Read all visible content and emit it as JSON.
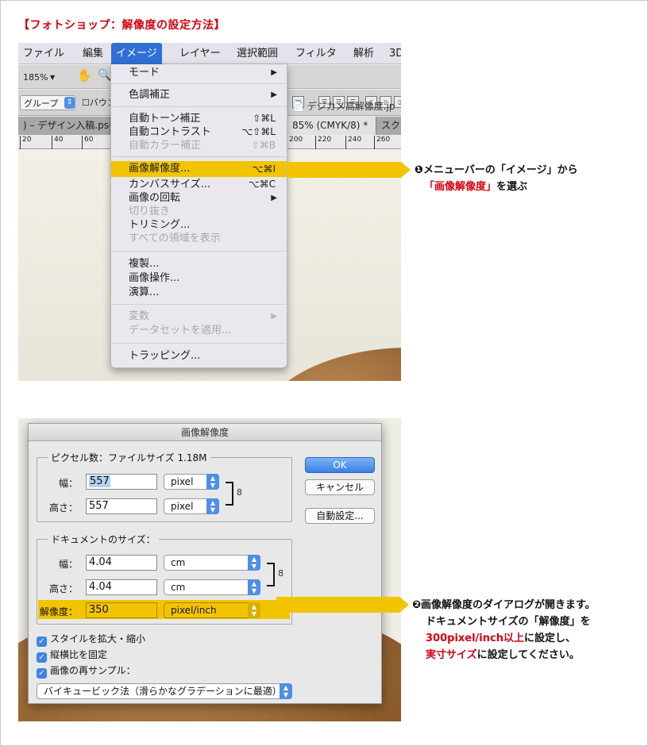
{
  "page_title": "【フォトショップ：解像度の設定方法】",
  "screenshot1": {
    "menubar": [
      "ファイル",
      "編集",
      "イメージ",
      "レイヤー",
      "選択範囲",
      "フィルタ",
      "解析",
      "3D"
    ],
    "active_menu": "イメージ",
    "options_bar": {
      "zoom": "185%",
      "zoom_arrow": "▼",
      "group_select": "グループ",
      "bounds_checkbox": "バウン"
    },
    "tabs": [
      ") – デザイン入稿.psd",
      "85% (CMYK/8) *",
      "スク"
    ],
    "doc_tab": "デジカメ高解像度.jp",
    "ruler_ticks": [
      "20",
      "40",
      "60",
      "200",
      "220",
      "240",
      "260"
    ],
    "image_menu": [
      {
        "label": "モード",
        "shortcut": "",
        "submenu": true,
        "disabled": false
      },
      {
        "label": "色調補正",
        "shortcut": "",
        "submenu": true,
        "disabled": false
      },
      {
        "label": "自動トーン補正",
        "shortcut": "⇧⌘L",
        "submenu": false,
        "disabled": false
      },
      {
        "label": "自動コントラスト",
        "shortcut": "⌥⇧⌘L",
        "submenu": false,
        "disabled": false
      },
      {
        "label": "自動カラー補正",
        "shortcut": "⇧⌘B",
        "submenu": false,
        "disabled": true
      },
      {
        "label": "画像解像度...",
        "shortcut": "⌥⌘I",
        "submenu": false,
        "disabled": false,
        "highlight": true
      },
      {
        "label": "カンバスサイズ...",
        "shortcut": "⌥⌘C",
        "submenu": false,
        "disabled": false
      },
      {
        "label": "画像の回転",
        "shortcut": "",
        "submenu": true,
        "disabled": false
      },
      {
        "label": "切り抜き",
        "shortcut": "",
        "submenu": false,
        "disabled": true
      },
      {
        "label": "トリミング...",
        "shortcut": "",
        "submenu": false,
        "disabled": false
      },
      {
        "label": "すべての領域を表示",
        "shortcut": "",
        "submenu": false,
        "disabled": true
      },
      {
        "label": "複製...",
        "shortcut": "",
        "submenu": false,
        "disabled": false
      },
      {
        "label": "画像操作...",
        "shortcut": "",
        "submenu": false,
        "disabled": false
      },
      {
        "label": "演算...",
        "shortcut": "",
        "submenu": false,
        "disabled": false
      },
      {
        "label": "変数",
        "shortcut": "",
        "submenu": true,
        "disabled": true
      },
      {
        "label": "データセットを適用...",
        "shortcut": "",
        "submenu": false,
        "disabled": true
      },
      {
        "label": "トラッピング...",
        "shortcut": "",
        "submenu": false,
        "disabled": false
      }
    ],
    "submenu_arrow": "▶"
  },
  "callout1": {
    "number": "❶",
    "line1": "メニューバーの「イメージ」から",
    "line2_red": "「画像解像度」",
    "line2_rest": "を選ぶ"
  },
  "dialog": {
    "title": "画像解像度",
    "pixel_group": "ピクセル数：ファイルサイズ 1.18M",
    "width_label": "幅：",
    "height_label": "高さ：",
    "pixel_width": "557",
    "pixel_height": "557",
    "pixel_unit": "pixel",
    "doc_group": "ドキュメントのサイズ：",
    "doc_width": "4.04",
    "doc_height": "4.04",
    "doc_unit": "cm",
    "resolution_label": "解像度：",
    "resolution": "350",
    "resolution_unit": "pixel/inch",
    "ok": "OK",
    "cancel": "キャンセル",
    "auto": "自動設定...",
    "check_scale": "スタイルを拡大・縮小",
    "check_constrain": "縦横比を固定",
    "check_resample": "画像の再サンプル：",
    "resample_method": "バイキュービック法（滑らかなグラデーションに最適）",
    "check_mark": "✓",
    "link_icon": "8"
  },
  "callout2": {
    "number": "❷",
    "line1": "画像解像度のダイアログが開きます。",
    "line2": "ドキュメントサイズの「解像度」を",
    "line3_red": "300pixel/inch以上",
    "line3_rest": "に設定し、",
    "line4_red": "実寸サイズ",
    "line4_rest": "に設定してください。"
  },
  "colors": {
    "accent_red": "#d7000f",
    "highlight_yellow": "#f2c400",
    "menu_blue": "#2f6fd6"
  }
}
